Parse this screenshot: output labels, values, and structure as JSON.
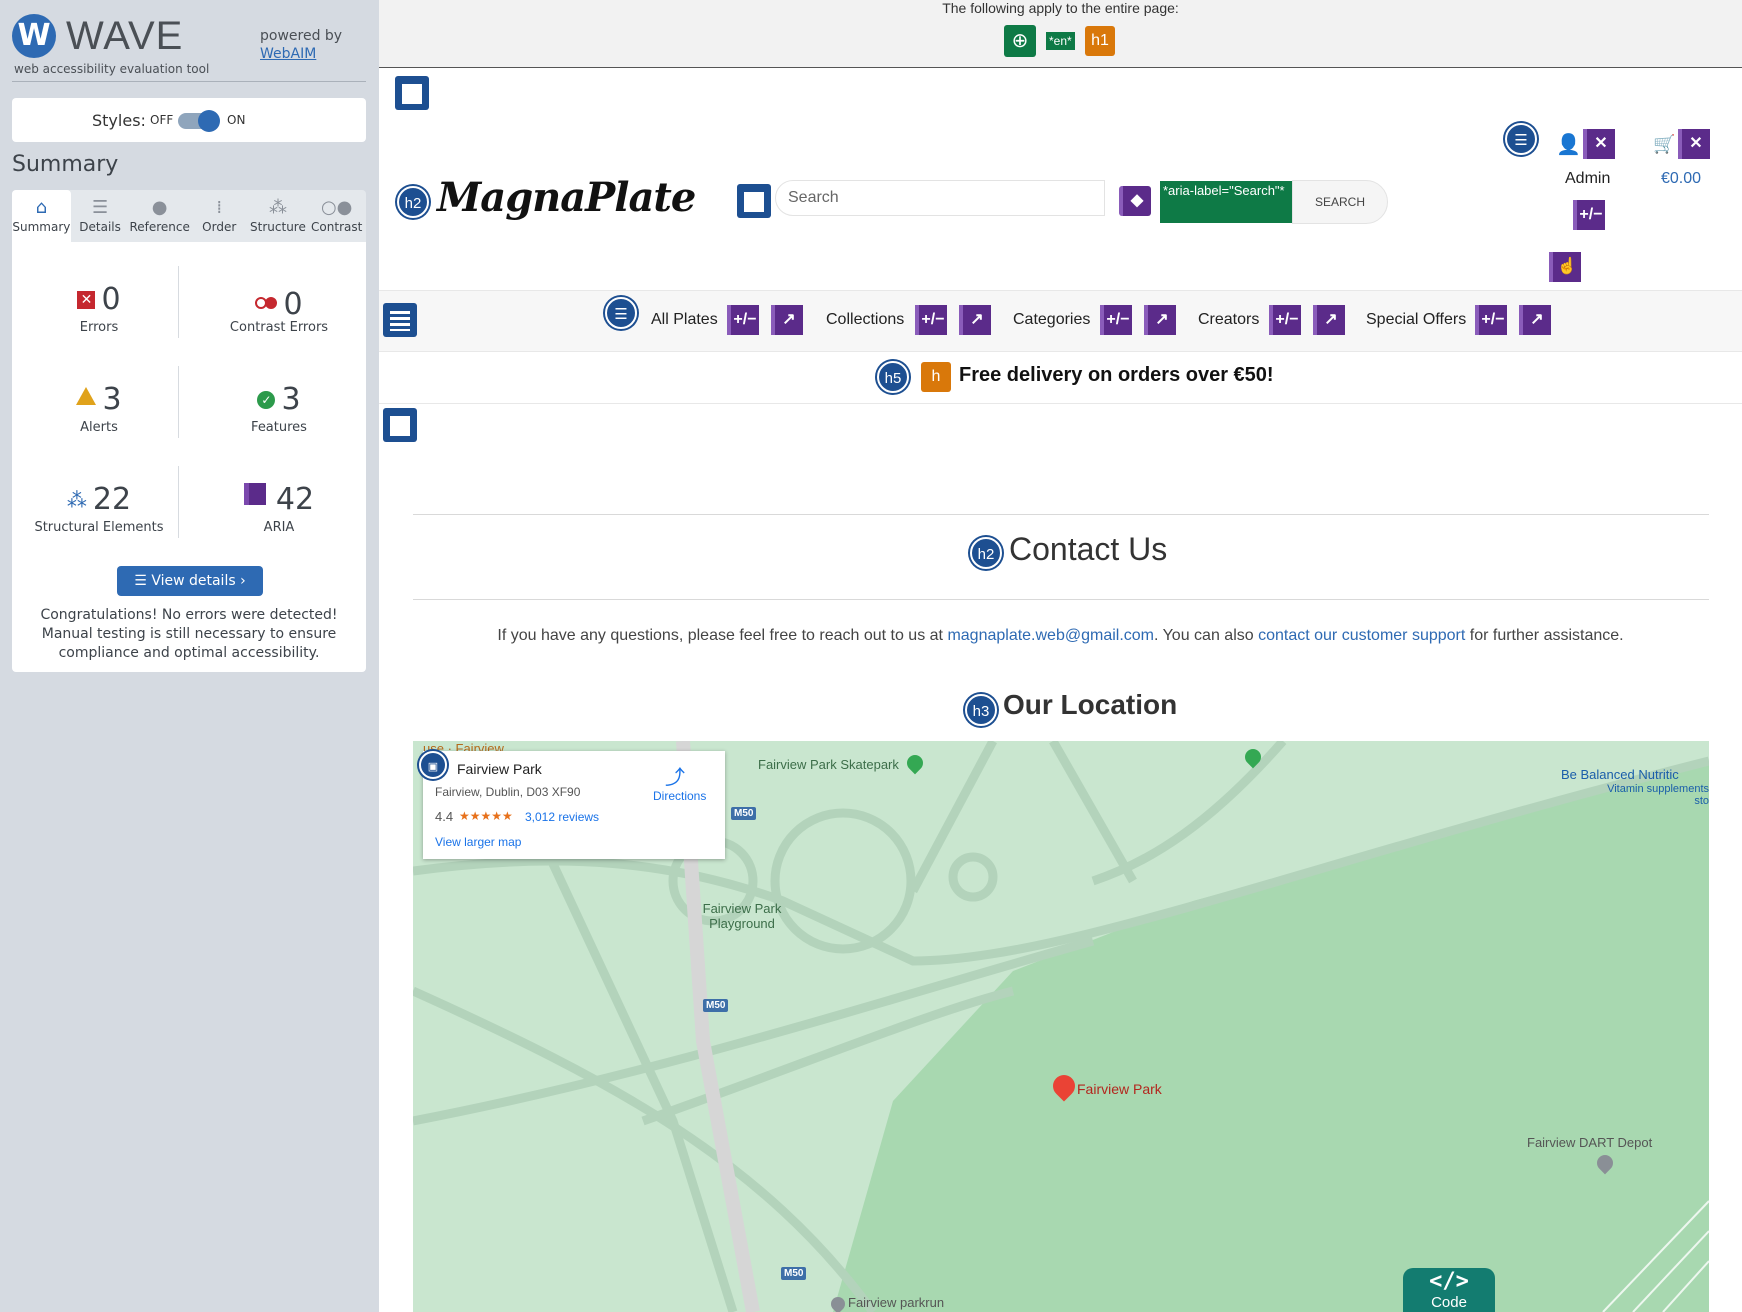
{
  "wave": {
    "name": "WAVE",
    "logo_letter": "W",
    "tagline": "web accessibility evaluation tool",
    "powered_by": "powered by",
    "webaim": "WebAIM",
    "styles_label": "Styles:",
    "styles_off": "OFF",
    "styles_on": "ON",
    "summary_title": "Summary",
    "tabs": [
      {
        "label": "Summary",
        "icon": "home-icon"
      },
      {
        "label": "Details",
        "icon": "list-icon"
      },
      {
        "label": "Reference",
        "icon": "info-icon"
      },
      {
        "label": "Order",
        "icon": "order-icon"
      },
      {
        "label": "Structure",
        "icon": "structure-icon"
      },
      {
        "label": "Contrast",
        "icon": "contrast-icon"
      }
    ],
    "stats": {
      "errors": {
        "count": "0",
        "label": "Errors"
      },
      "contrast": {
        "count": "0",
        "label": "Contrast Errors"
      },
      "alerts": {
        "count": "3",
        "label": "Alerts"
      },
      "features": {
        "count": "3",
        "label": "Features"
      },
      "structure": {
        "count": "22",
        "label": "Structural Elements"
      },
      "aria": {
        "count": "42",
        "label": "ARIA"
      }
    },
    "view_details": "View details ›",
    "congrats": "Congratulations! No errors were detected! Manual testing is still necessary to ensure compliance and optimal accessibility."
  },
  "page": {
    "entire_page_note": "The following apply to the entire page:",
    "lang_tag": "*en*",
    "h1_marker": "h1",
    "logo": "MagnaPlate",
    "search_placeholder": "Search",
    "aria_label_tag": "*aria-label=\"Search\"*",
    "search_button": "SEARCH",
    "admin": "Admin",
    "cart_amount": "€0.00",
    "nav": [
      "All Plates",
      "Collections",
      "Categories",
      "Creators",
      "Special Offers"
    ],
    "delivery": "Free delivery on orders over €50!",
    "contact_title": "Contact Us",
    "contact_text_pre": "If you have any questions, please feel free to reach out to us at ",
    "contact_email": "magnaplate.web@gmail.com",
    "contact_text_mid": ". You can also ",
    "contact_link": "contact our customer support",
    "contact_text_post": " for further assistance.",
    "location_title": "Our Location",
    "markers": {
      "h2": "h2",
      "h3": "h3",
      "h5": "h5",
      "plusminus": "+/−"
    },
    "code_button": "Code",
    "code_symbol": "</>"
  },
  "map": {
    "card_title": "Fairview Park",
    "card_address": "Fairview, Dublin, D03 XF90",
    "rating": "4.4",
    "stars": "★★★★★",
    "reviews": "3,012 reviews",
    "larger_map": "View larger map",
    "directions": "Directions",
    "top_label": "use · Fairview",
    "labels": {
      "skatepark": "Fairview Park Skatepark",
      "playground": "Fairview Park Playground",
      "balanced": "Be Balanced Nutritic",
      "vitamin": "Vitamin supplements sto",
      "park": "Fairview Park",
      "dart": "Fairview DART Depot",
      "parkrun": "Fairview parkrun"
    },
    "road": "M50",
    "colors": {
      "park": "#a8d8b0",
      "grass": "#c9e6cf",
      "path": "#b3d3bb",
      "pin_red": "#ea4335",
      "pin_green": "#34a853"
    }
  }
}
